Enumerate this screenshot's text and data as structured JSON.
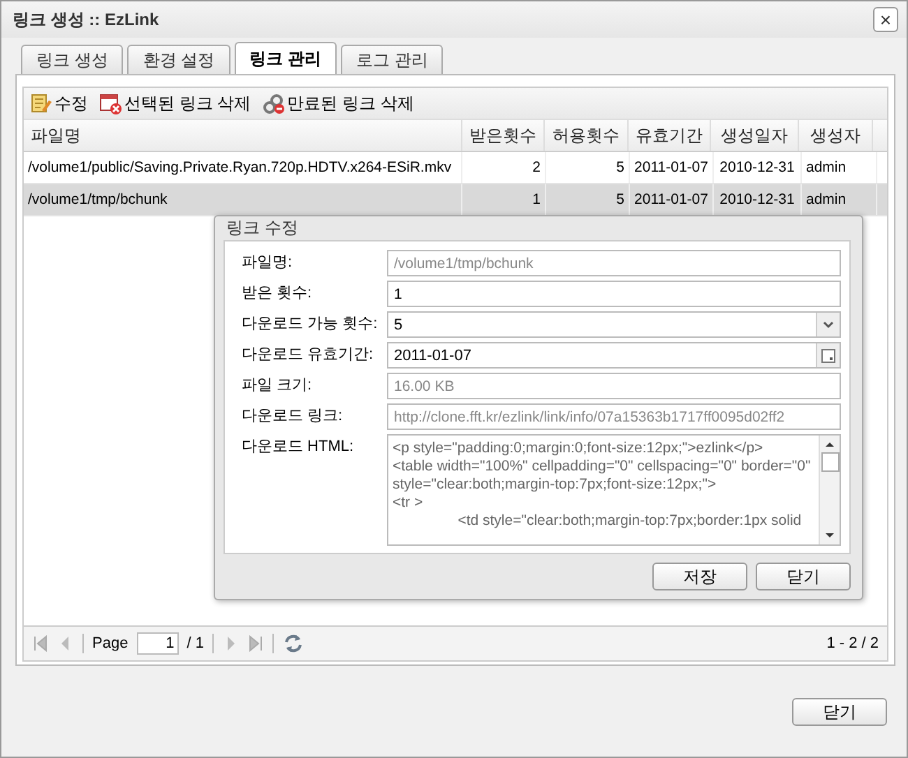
{
  "window": {
    "title": "링크 생성 :: EzLink",
    "close": "×"
  },
  "tabs": [
    {
      "label": "링크 생성",
      "selected": false
    },
    {
      "label": "환경 설정",
      "selected": false
    },
    {
      "label": "링크 관리",
      "selected": true
    },
    {
      "label": "로그 관리",
      "selected": false
    }
  ],
  "toolbar": [
    {
      "kind": "edit",
      "label": "수정"
    },
    {
      "kind": "delete",
      "label": "선택된 링크 삭제"
    },
    {
      "kind": "expired",
      "label": "만료된 링크 삭제"
    }
  ],
  "table": {
    "columns": [
      "파일명",
      "받은횟수",
      "허용횟수",
      "유효기간",
      "생성일자",
      "생성자"
    ],
    "rows": [
      {
        "selected": false,
        "cells": [
          "/volume1/public/Saving.Private.Ryan.720p.HDTV.x264-ESiR.mkv",
          "2",
          "5",
          "2011-01-07",
          "2010-12-31",
          "admin"
        ]
      },
      {
        "selected": true,
        "cells": [
          "/volume1/tmp/bchunk",
          "1",
          "5",
          "2011-01-07",
          "2010-12-31",
          "admin"
        ]
      }
    ]
  },
  "dialog": {
    "title": "링크 수정",
    "fields": [
      {
        "kind": "text",
        "label": "파일명:",
        "value": "/volume1/tmp/bchunk",
        "disabled": true
      },
      {
        "kind": "text",
        "label": "받은 횟수:",
        "value": "1",
        "disabled": false
      },
      {
        "kind": "select",
        "label": "다운로드 가능 횟수:",
        "value": "5",
        "disabled": false
      },
      {
        "kind": "date",
        "label": "다운로드 유효기간:",
        "value": "2011-01-07",
        "disabled": false
      },
      {
        "kind": "text",
        "label": "파일 크기:",
        "value": "16.00 KB",
        "disabled": true
      },
      {
        "kind": "text",
        "label": "다운로드 링크:",
        "value": "http://clone.fft.kr/ezlink/link/info/07a15363b1717ff0095d02ff2",
        "disabled": true
      },
      {
        "kind": "textarea",
        "label": "다운로드 HTML:",
        "value": "<p style=\"padding:0;margin:0;font-size:12px;\">ezlink</p>\n<table width=\"100%\" cellpadding=\"0\" cellspacing=\"0\" border=\"0\" style=\"clear:both;margin-top:7px;font-size:12px;\">\n<tr >\n                <td style=\"clear:both;margin-top:7px;border:1px solid",
        "disabled": true
      }
    ],
    "buttons": [
      "저장",
      "닫기"
    ]
  },
  "pager": {
    "page_label": "Page",
    "page": "1",
    "total": "/ 1",
    "summary": "1 - 2 / 2"
  },
  "footer": {
    "button": "닫기"
  }
}
